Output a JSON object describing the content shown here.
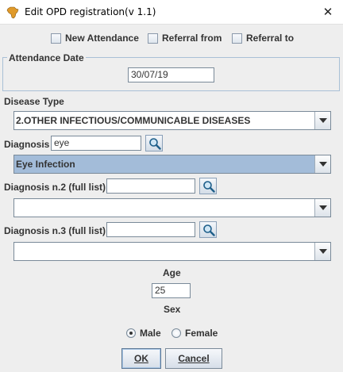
{
  "window": {
    "title": "Edit OPD registration(v 1.1)",
    "close_symbol": "✕",
    "app_icon": "africa-map-icon"
  },
  "options": {
    "new_attendance": {
      "label": "New Attendance",
      "checked": false
    },
    "referral_from": {
      "label": "Referral from",
      "checked": false
    },
    "referral_to": {
      "label": "Referral to",
      "checked": false
    }
  },
  "attendance": {
    "legend": "Attendance Date",
    "date": "30/07/19"
  },
  "disease_type": {
    "label": "Disease Type",
    "selected": "2.OTHER INFECTIOUS/COMMUNICABLE DISEASES"
  },
  "diagnosis": {
    "label": "Diagnosis",
    "search_value": "eye",
    "selected": "Eye Infection"
  },
  "diagnosis2": {
    "label": "Diagnosis n.2 (full list)",
    "search_value": "",
    "selected": ""
  },
  "diagnosis3": {
    "label": "Diagnosis n.3 (full list)",
    "search_value": "",
    "selected": ""
  },
  "age": {
    "label": "Age",
    "value": "25"
  },
  "sex": {
    "label": "Sex",
    "options": [
      {
        "label": "Male",
        "selected": true
      },
      {
        "label": "Female",
        "selected": false
      }
    ]
  },
  "buttons": {
    "ok": "OK",
    "cancel": "Cancel"
  }
}
